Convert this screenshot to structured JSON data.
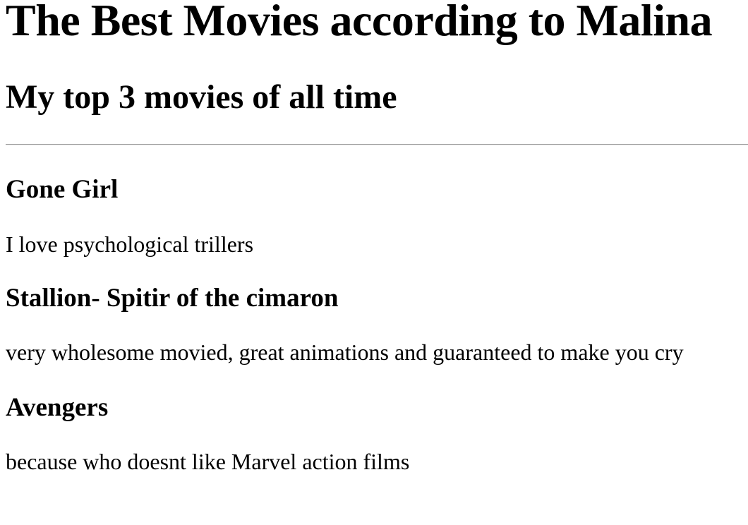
{
  "page": {
    "title": "The Best Movies according to Malina",
    "subtitle": "My top 3 movies of all time"
  },
  "movies": [
    {
      "title": "Gone Girl",
      "description": "I love psychological trillers"
    },
    {
      "title": "Stallion- Spitir of the cimaron",
      "description": "very wholesome movied, great animations and guaranteed to make you cry"
    },
    {
      "title": "Avengers",
      "description": "because who doesnt like Marvel action films"
    }
  ]
}
